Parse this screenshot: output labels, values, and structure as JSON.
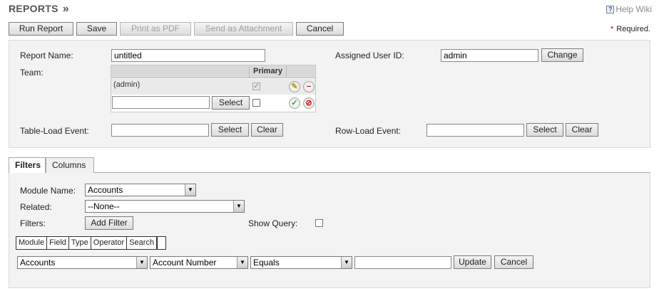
{
  "header": {
    "title": "REPORTS",
    "chevron": "»",
    "help_label": "Help Wiki",
    "help_icon": "help-book-icon",
    "required_marker": "*",
    "required_label": "Required."
  },
  "toolbar": {
    "run_report": "Run Report",
    "save": "Save",
    "print_pdf": "Print as PDF",
    "send_attachment": "Send as Attachment",
    "cancel": "Cancel"
  },
  "form": {
    "report_name_label": "Report Name:",
    "report_name_value": "untitled",
    "assigned_user_label": "Assigned User ID:",
    "assigned_user_value": "admin",
    "change_button": "Change",
    "team_label": "Team:",
    "team_table": {
      "primary_header": "Primary",
      "row_value": "(admin)",
      "new_row_value": "",
      "select_button": "Select"
    },
    "table_load_label": "Table-Load Event:",
    "table_load_value": "",
    "row_load_label": "Row-Load Event:",
    "row_load_value": "",
    "select_button": "Select",
    "clear_button": "Clear"
  },
  "tabs": [
    {
      "label": "Filters",
      "active": true
    },
    {
      "label": "Columns",
      "active": false
    }
  ],
  "filters": {
    "module_name_label": "Module Name:",
    "module_name_value": "Accounts",
    "related_label": "Related:",
    "related_value": "--None--",
    "filters_label": "Filters:",
    "add_filter_button": "Add Filter",
    "show_query_label": "Show Query:",
    "columns": [
      "Module",
      "Field",
      "Type",
      "Operator",
      "Search"
    ],
    "row": {
      "module": "Accounts",
      "field": "Account Number",
      "operator": "Equals",
      "search_value": "",
      "update_button": "Update",
      "cancel_button": "Cancel"
    }
  },
  "colors": {
    "panel_bg": "#f3f3f3",
    "required_star": "#cc0000",
    "title_text": "#555555"
  }
}
